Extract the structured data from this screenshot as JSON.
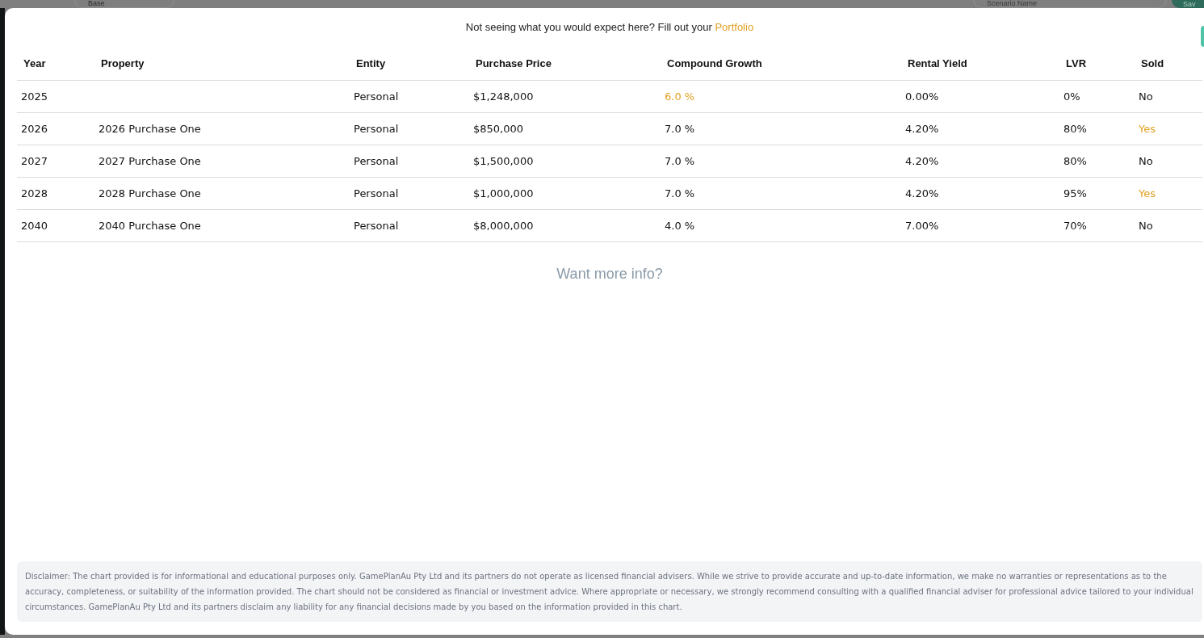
{
  "background": {
    "dropdown": "Base",
    "scenario_field": {
      "placeholder": "Scenario Name"
    },
    "save_button": "Sav"
  },
  "modal": {
    "notice": "Not seeing what you would expect here? Fill out your",
    "notice_link": "Portfolio",
    "table": {
      "columns": [
        "Year",
        "Property",
        "Entity",
        "Purchase Price",
        "Compound Growth",
        "Rental Yield",
        "LVR",
        "Sold"
      ],
      "rows": [
        {
          "year": "2025",
          "property": "",
          "entity": "Personal",
          "price": "$1,248,000",
          "growth": "6.0 %",
          "growth_highlighted": true,
          "yield": "0.00%",
          "lvr": "0%",
          "sold": "No",
          "sold_highlighted": false
        },
        {
          "year": "2026",
          "property": "2026 Purchase One",
          "entity": "Personal",
          "price": "$850,000",
          "growth": "7.0 %",
          "growth_highlighted": false,
          "yield": "4.20%",
          "lvr": "80%",
          "sold": "Yes",
          "sold_highlighted": true
        },
        {
          "year": "2027",
          "property": "2027 Purchase One",
          "entity": "Personal",
          "price": "$1,500,000",
          "growth": "7.0 %",
          "growth_highlighted": false,
          "yield": "4.20%",
          "lvr": "80%",
          "sold": "No",
          "sold_highlighted": false
        },
        {
          "year": "2028",
          "property": "2028 Purchase One",
          "entity": "Personal",
          "price": "$1,000,000",
          "growth": "7.0 %",
          "growth_highlighted": false,
          "yield": "4.20%",
          "lvr": "95%",
          "sold": "Yes",
          "sold_highlighted": true
        },
        {
          "year": "2040",
          "property": "2040 Purchase One",
          "entity": "Personal",
          "price": "$8,000,000",
          "growth": "4.0 %",
          "growth_highlighted": false,
          "yield": "7.00%",
          "lvr": "70%",
          "sold": "No",
          "sold_highlighted": false
        }
      ]
    },
    "more_info": "Want more info?",
    "disclaimer": "Disclaimer: The chart provided is for informational and educational purposes only. GamePlanAu Pty Ltd and its partners do not operate as licensed financial advisers. While we strive to provide accurate and up-to-date information, we make no warranties or representations as to the accuracy, completeness, or suitability of the information provided. The chart should not be considered as financial or investment advice. Where appropriate or necessary, we strongly recommend consulting with a qualified financial adviser for professional advice tailored to your individual circumstances. GamePlanAu Pty Ltd and its partners disclaim any liability for any financial decisions made by you based on the information provided in this chart."
  }
}
